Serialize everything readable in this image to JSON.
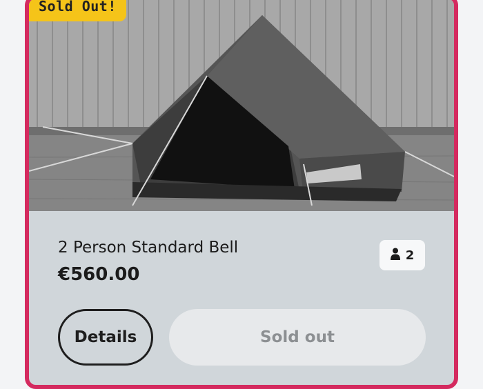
{
  "product": {
    "badge": "Sold Out!",
    "name": "2 Person Standard Bell",
    "price": "€560.00",
    "capacity": "2",
    "capacity_icon": "person-icon"
  },
  "actions": {
    "details_label": "Details",
    "soldout_label": "Sold out"
  },
  "colors": {
    "card_border": "#d42a5f",
    "badge_bg": "#f5c419",
    "card_bg": "#d0d6da"
  }
}
